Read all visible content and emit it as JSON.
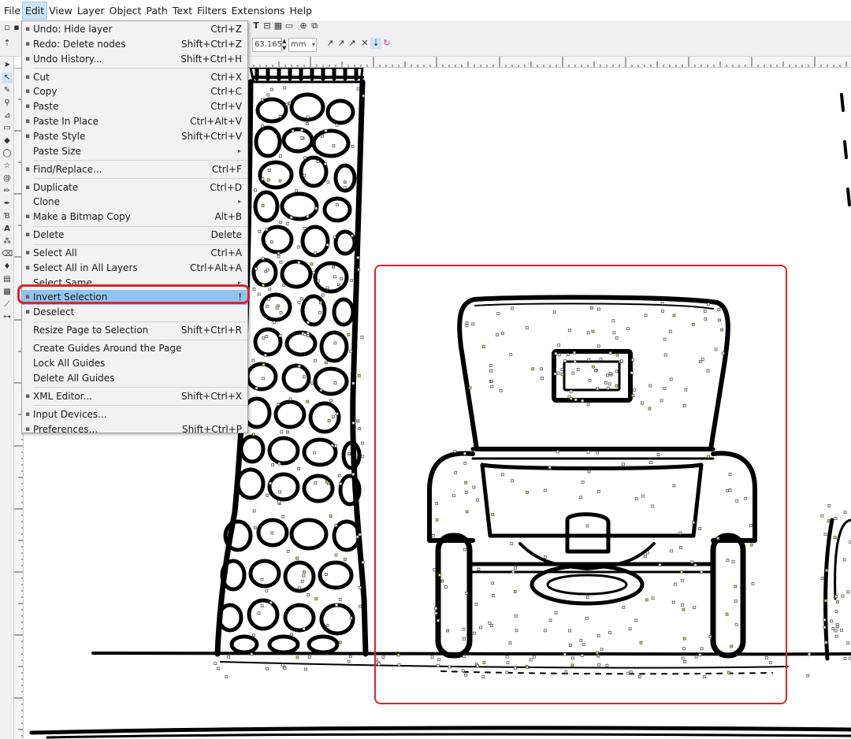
{
  "menubar": [
    {
      "label": "File",
      "name": "menu-file"
    },
    {
      "label": "Edit",
      "name": "menu-edit",
      "active": true
    },
    {
      "label": "View",
      "name": "menu-view"
    },
    {
      "label": "Layer",
      "name": "menu-layer"
    },
    {
      "label": "Object",
      "name": "menu-object"
    },
    {
      "label": "Path",
      "name": "menu-path"
    },
    {
      "label": "Text",
      "name": "menu-text"
    },
    {
      "label": "Filters",
      "name": "menu-filters"
    },
    {
      "label": "Extensions",
      "name": "menu-extensions"
    },
    {
      "label": "Help",
      "name": "menu-help"
    }
  ],
  "toolbar": {
    "zoom_value": "63.165",
    "unit": "mm"
  },
  "edit_menu": {
    "groups": [
      [
        {
          "label": "Undo: Hide layer",
          "shortcut": "Ctrl+Z",
          "icon": "undo-icon"
        },
        {
          "label": "Redo: Delete nodes",
          "shortcut": "Shift+Ctrl+Z",
          "icon": "redo-icon"
        },
        {
          "label": "Undo History...",
          "shortcut": "Shift+Ctrl+H",
          "icon": "history-icon"
        }
      ],
      [
        {
          "label": "Cut",
          "shortcut": "Ctrl+X",
          "icon": "cut-icon"
        },
        {
          "label": "Copy",
          "shortcut": "Ctrl+C",
          "icon": "copy-icon"
        },
        {
          "label": "Paste",
          "shortcut": "Ctrl+V",
          "icon": "paste-icon"
        },
        {
          "label": "Paste In Place",
          "shortcut": "Ctrl+Alt+V",
          "icon": "paste-in-place-icon"
        },
        {
          "label": "Paste Style",
          "shortcut": "Shift+Ctrl+V",
          "icon": "paste-style-icon"
        },
        {
          "label": "Paste Size",
          "shortcut": "",
          "submenu": true
        }
      ],
      [
        {
          "label": "Find/Replace...",
          "shortcut": "Ctrl+F",
          "icon": "find-icon"
        }
      ],
      [
        {
          "label": "Duplicate",
          "shortcut": "Ctrl+D",
          "icon": "duplicate-icon"
        },
        {
          "label": "Clone",
          "shortcut": "",
          "submenu": true
        },
        {
          "label": "Make a Bitmap Copy",
          "shortcut": "Alt+B",
          "icon": "bitmap-copy-icon"
        }
      ],
      [
        {
          "label": "Delete",
          "shortcut": "Delete",
          "icon": "delete-icon"
        }
      ],
      [
        {
          "label": "Select All",
          "shortcut": "Ctrl+A",
          "icon": "select-all-icon"
        },
        {
          "label": "Select All in All Layers",
          "shortcut": "Ctrl+Alt+A",
          "icon": "select-all-layers-icon"
        },
        {
          "label": "Select Same",
          "shortcut": "",
          "submenu": true
        },
        {
          "label": "Invert Selection",
          "shortcut": "!",
          "icon": "invert-selection-icon",
          "highlighted": true
        },
        {
          "label": "Deselect",
          "shortcut": "",
          "icon": "deselect-icon"
        }
      ],
      [
        {
          "label": "Resize Page to Selection",
          "shortcut": "Shift+Ctrl+R"
        }
      ],
      [
        {
          "label": "Create Guides Around the Page",
          "shortcut": ""
        },
        {
          "label": "Lock All Guides",
          "shortcut": ""
        },
        {
          "label": "Delete All Guides",
          "shortcut": ""
        }
      ],
      [
        {
          "label": "XML Editor...",
          "shortcut": "Shift+Ctrl+X",
          "icon": "xml-editor-icon"
        }
      ],
      [
        {
          "label": "Input Devices...",
          "shortcut": "",
          "icon": "input-devices-icon"
        },
        {
          "label": "Preferences...",
          "shortcut": "Shift+Ctrl+P",
          "icon": "preferences-icon"
        }
      ]
    ]
  },
  "colors": {
    "annotation_red": "#d9262b",
    "menu_highlight": "#92c4f2"
  }
}
